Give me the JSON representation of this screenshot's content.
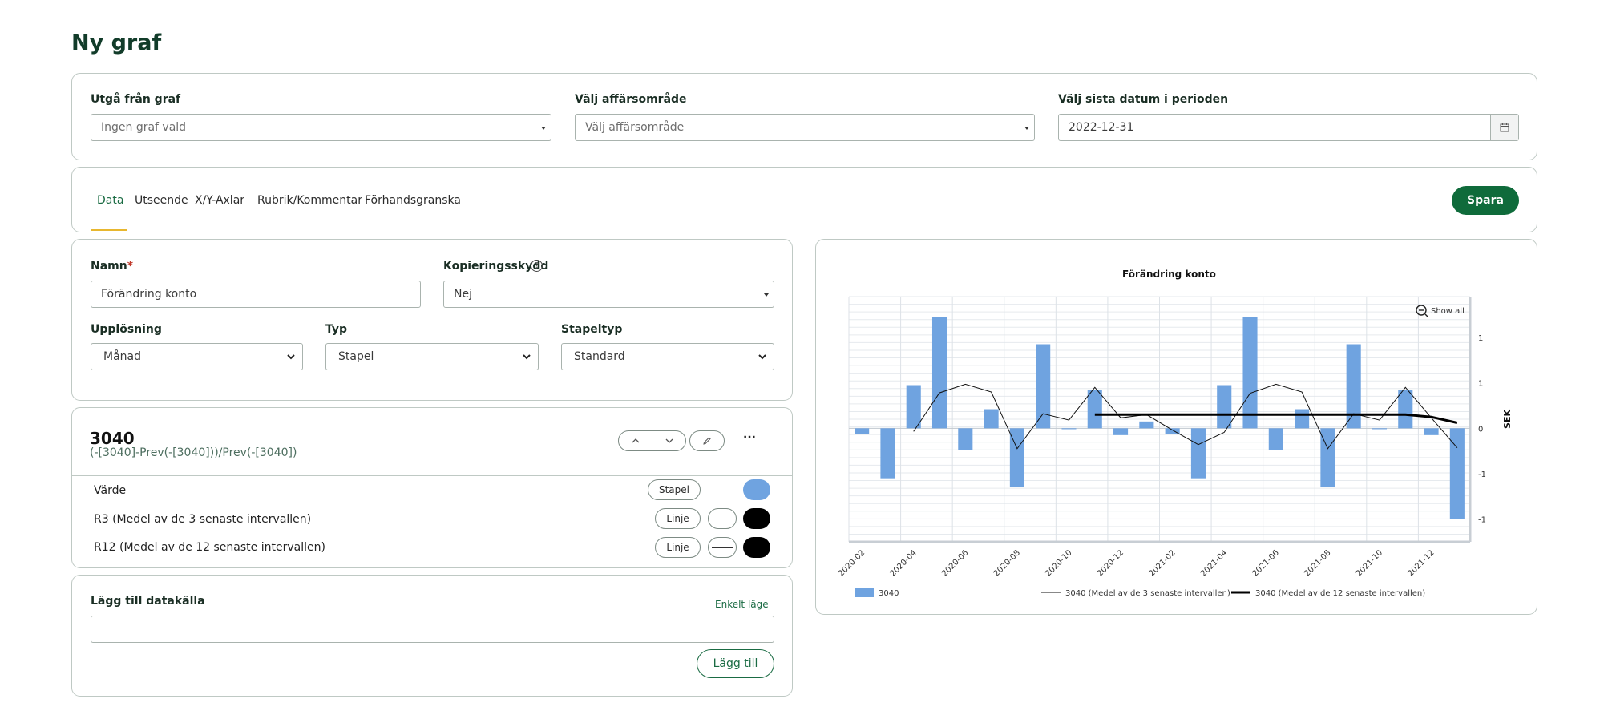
{
  "page": {
    "title": "Ny graf"
  },
  "filters": {
    "base_graph": {
      "label": "Utgå från graf",
      "placeholder": "Ingen graf vald"
    },
    "business_area": {
      "label": "Välj affärsområde",
      "placeholder": "Välj affärsområde"
    },
    "last_date": {
      "label": "Välj sista datum i perioden",
      "value": "2022-12-31",
      "icon": "calendar-icon"
    }
  },
  "tabs": [
    {
      "label": "Data",
      "active": true
    },
    {
      "label": "Utseende",
      "active": false
    },
    {
      "label": "X/Y-Axlar",
      "active": false
    },
    {
      "label": "Rubrik/Kommentar",
      "active": false
    },
    {
      "label": "Förhandsgranska",
      "active": false
    }
  ],
  "save_button": "Spara",
  "settings": {
    "name_label": "Namn",
    "name_required_mark": "*",
    "name_value": "Förändring konto",
    "copy_protect_label": "Kopieringsskydd",
    "copy_protect_help": "?",
    "copy_protect_value": "Nej",
    "resolution_label": "Upplösning",
    "resolution_value": "Månad",
    "type_label": "Typ",
    "type_value": "Stapel",
    "bar_type_label": "Stapeltyp",
    "bar_type_value": "Standard"
  },
  "series_block": {
    "title": "3040",
    "formula": "(-[3040]-Prev(-[3040]))/Prev(-[3040])",
    "more": "···",
    "rows": [
      {
        "label": "Värde",
        "type": "Stapel",
        "color": "#6fa3e0"
      },
      {
        "label": "R3 (Medel av de 3 senaste intervallen)",
        "type": "Linje",
        "color": "#000000"
      },
      {
        "label": "R12 (Medel av de 12 senaste intervallen)",
        "type": "Linje",
        "color": "#000000"
      }
    ]
  },
  "add_source": {
    "label": "Lägg till datakälla",
    "simple_mode": "Enkelt läge",
    "input_value": "",
    "button": "Lägg till"
  },
  "chart_data": {
    "type": "bar",
    "title": "Förändring konto",
    "ylabel": "SEK",
    "xlabel": "",
    "show_all": "Show all",
    "x_tick_labels": [
      "2020-02",
      "2020-04",
      "2020-06",
      "2020-08",
      "2020-10",
      "2020-12",
      "2021-02",
      "2021-04",
      "2021-06",
      "2021-08",
      "2021-10",
      "2021-12"
    ],
    "y_tick_labels": [
      "1",
      "1",
      "0",
      "-1",
      "-1"
    ],
    "y_tick_values": [
      2,
      1,
      0,
      -1,
      -2
    ],
    "ylim": [
      -2.5,
      2.9
    ],
    "categories": [
      "2020-02",
      "2020-03",
      "2020-04",
      "2020-05",
      "2020-06",
      "2020-07",
      "2020-08",
      "2020-09",
      "2020-10",
      "2020-11",
      "2020-12",
      "2021-01",
      "2021-02",
      "2021-03",
      "2021-04",
      "2021-05",
      "2021-06",
      "2021-07",
      "2021-08",
      "2021-09",
      "2021-10",
      "2021-11",
      "2021-12",
      "2022-01"
    ],
    "series": [
      {
        "name": "3040",
        "kind": "bar",
        "color": "#6fa3e0",
        "values": [
          -0.12,
          -1.1,
          0.95,
          2.45,
          -0.48,
          0.42,
          -1.3,
          1.85,
          -0.02,
          0.85,
          -0.15,
          0.15,
          -0.12,
          -1.1,
          0.95,
          2.45,
          -0.48,
          0.42,
          -1.3,
          1.85,
          -0.02,
          0.85,
          -0.15,
          -2.0
        ]
      },
      {
        "name": "3040 (Medel av de 3 senaste intervallen)",
        "kind": "line",
        "color": "#111111",
        "width": 1,
        "values": [
          null,
          null,
          -0.07,
          0.78,
          0.97,
          0.8,
          -0.45,
          0.32,
          0.18,
          0.9,
          0.23,
          0.3,
          -0.04,
          -0.36,
          -0.09,
          0.77,
          0.97,
          0.8,
          -0.45,
          0.32,
          0.18,
          0.9,
          0.23,
          -0.43
        ]
      },
      {
        "name": "3040 (Medel av de 12 senaste intervallen)",
        "kind": "line",
        "color": "#000000",
        "width": 3,
        "values": [
          null,
          null,
          null,
          null,
          null,
          null,
          null,
          null,
          null,
          0.3,
          0.3,
          0.3,
          0.3,
          0.3,
          0.3,
          0.3,
          0.3,
          0.3,
          0.3,
          0.3,
          0.3,
          0.3,
          0.25,
          0.12
        ]
      }
    ],
    "grid": true,
    "legend_position": "bottom"
  }
}
